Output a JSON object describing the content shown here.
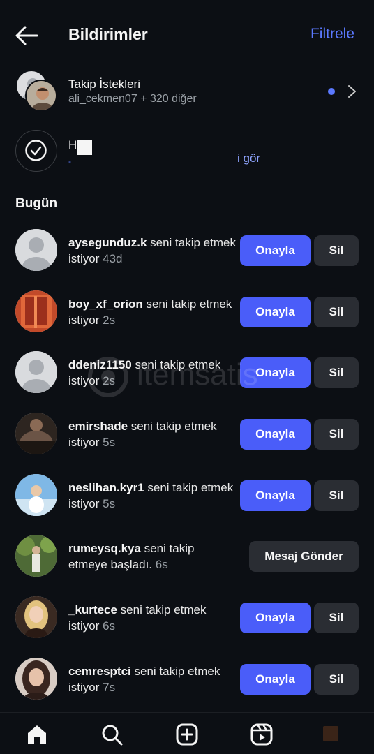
{
  "header": {
    "title": "Bildirimler",
    "filter_label": "Filtrele"
  },
  "follow_requests": {
    "title": "Takip İstekleri",
    "subtitle": "ali_cekmen07 + 320 diğer"
  },
  "second_row": {
    "title_partial": "H",
    "link_partial": "i gör"
  },
  "section_title": "Bugün",
  "accept_label": "Onayla",
  "delete_label": "Sil",
  "message_label": "Mesaj Gönder",
  "notifications": [
    {
      "username": "aysegunduz.k",
      "text": " seni takip etmek istiyor ",
      "time": "43d",
      "action": "request",
      "avatar": "default"
    },
    {
      "username": "boy_xf_orion",
      "text": " seni takip etmek istiyor ",
      "time": "2s",
      "action": "request",
      "avatar": "photo-red"
    },
    {
      "username": "ddeniz1150",
      "text": " seni takip etmek istiyor ",
      "time": "2s",
      "action": "request",
      "avatar": "default"
    },
    {
      "username": "emirshade",
      "text": " seni takip etmek istiyor ",
      "time": "5s",
      "action": "request",
      "avatar": "photo-dark"
    },
    {
      "username": "neslihan.kyr1",
      "text": " seni takip etmek istiyor ",
      "time": "5s",
      "action": "request",
      "avatar": "photo-blue"
    },
    {
      "username": "rumeysq.kya",
      "text": " seni takip etmeye başladı. ",
      "time": "6s",
      "action": "follow",
      "avatar": "photo-green"
    },
    {
      "username": "_kurtece",
      "text": " seni takip etmek istiyor ",
      "time": "6s",
      "action": "request",
      "avatar": "photo-blonde"
    },
    {
      "username": "cemresptci",
      "text": " seni takip etmek istiyor ",
      "time": "7s",
      "action": "request",
      "avatar": "photo-brunette"
    }
  ],
  "watermark": "itemsatis",
  "colors": {
    "background": "#0c0f14",
    "accent": "#4a5df9",
    "link": "#5b79ff",
    "secondary_button": "#2a2d33"
  },
  "icons": {
    "back": "arrow-left-icon",
    "chevron": "chevron-right-icon",
    "check": "check-circle-icon",
    "nav": [
      "home-icon",
      "search-icon",
      "add-post-icon",
      "reels-icon",
      "profile-icon"
    ]
  }
}
